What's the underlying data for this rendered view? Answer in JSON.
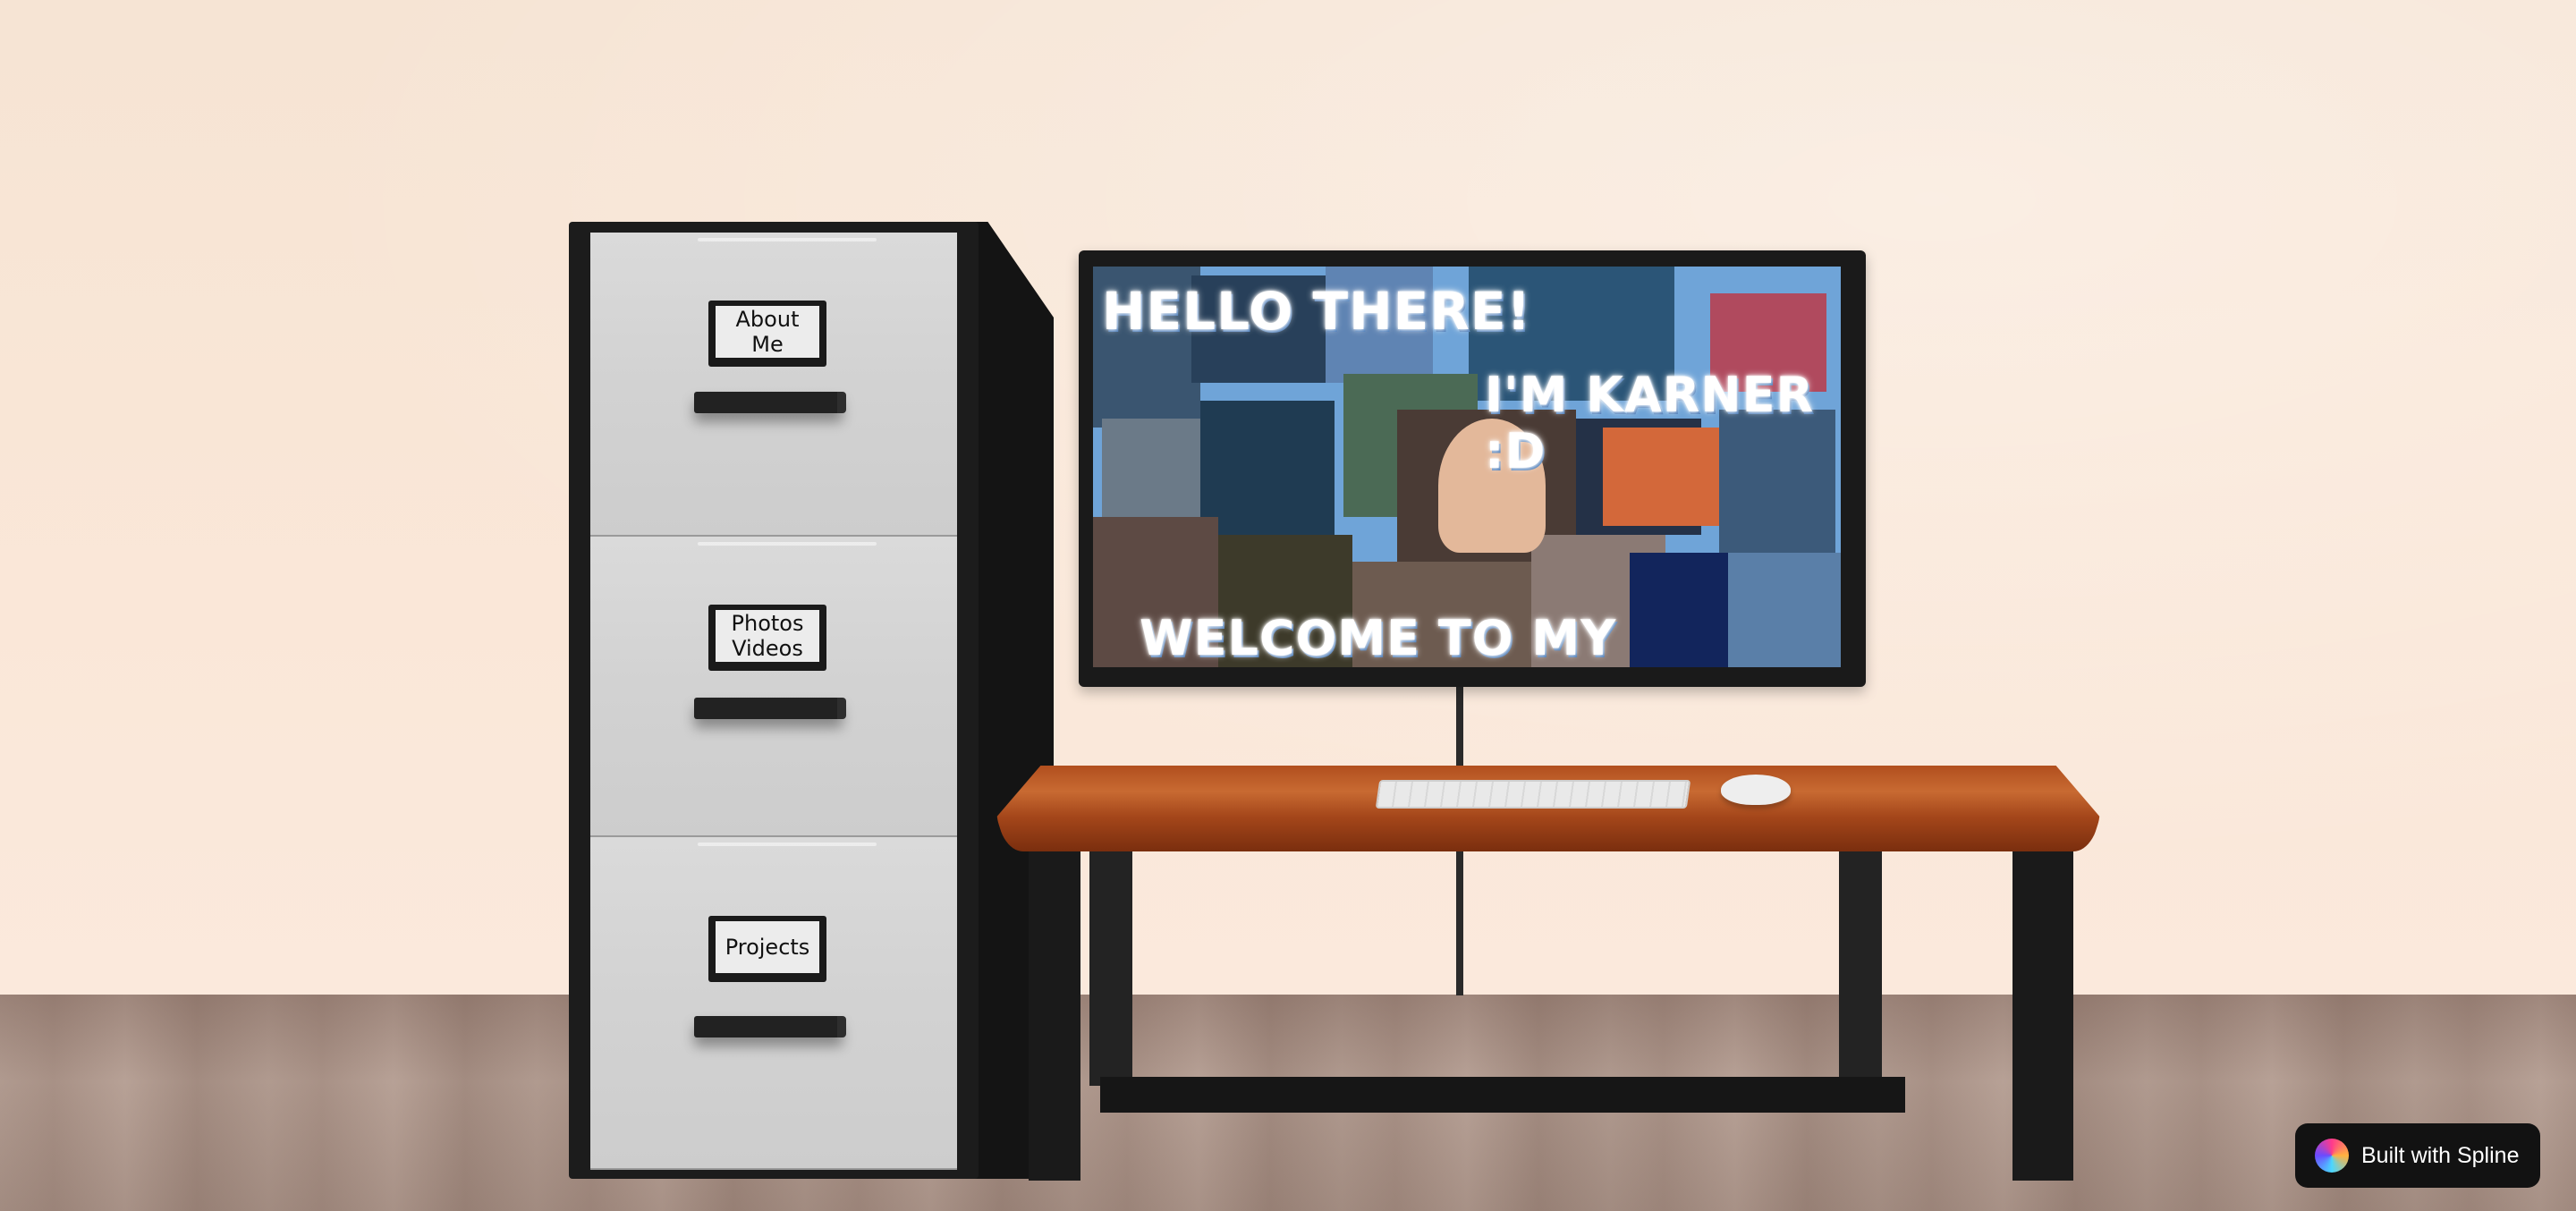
{
  "cabinet": {
    "drawers": [
      {
        "label": "About\nMe"
      },
      {
        "label": "Photos\nVideos"
      },
      {
        "label": "Projects"
      }
    ]
  },
  "monitor": {
    "headline": "HELLO THERE!",
    "subheadline": "I'M KARNER :D",
    "footer": "WELCOME TO MY WEBSITE"
  },
  "badge": {
    "label": "Built with Spline"
  },
  "colors": {
    "wall": "#f9e6d6",
    "floor": "#b09a8f",
    "desk": "#b14f1e",
    "screen_bg": "#6fa4d8",
    "badge_bg": "#121212"
  }
}
